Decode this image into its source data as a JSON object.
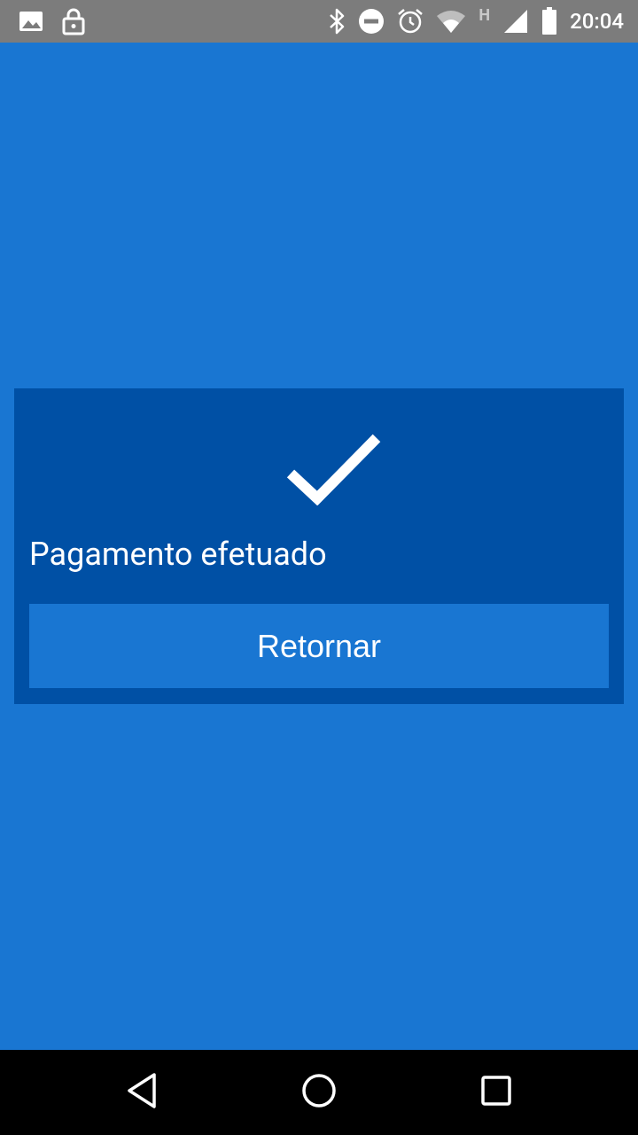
{
  "status_bar": {
    "time": "20:04",
    "network_type": "H",
    "left_icons": [
      "image-icon",
      "lock-icon"
    ],
    "right_icons": [
      "bluetooth-icon",
      "do-not-disturb-icon",
      "alarm-icon",
      "wifi-icon",
      "signal-icon",
      "battery-icon"
    ]
  },
  "dialog": {
    "message": "Pagamento efetuado",
    "button_label": "Retornar",
    "icon": "checkmark-icon"
  },
  "nav_bar": {
    "items": [
      "back-icon",
      "home-icon",
      "recents-icon"
    ]
  },
  "colors": {
    "background": "#1976d2",
    "card": "#0050a5",
    "status_bar": "#7c7c7c",
    "nav_bar": "#000000",
    "text": "#ffffff"
  }
}
